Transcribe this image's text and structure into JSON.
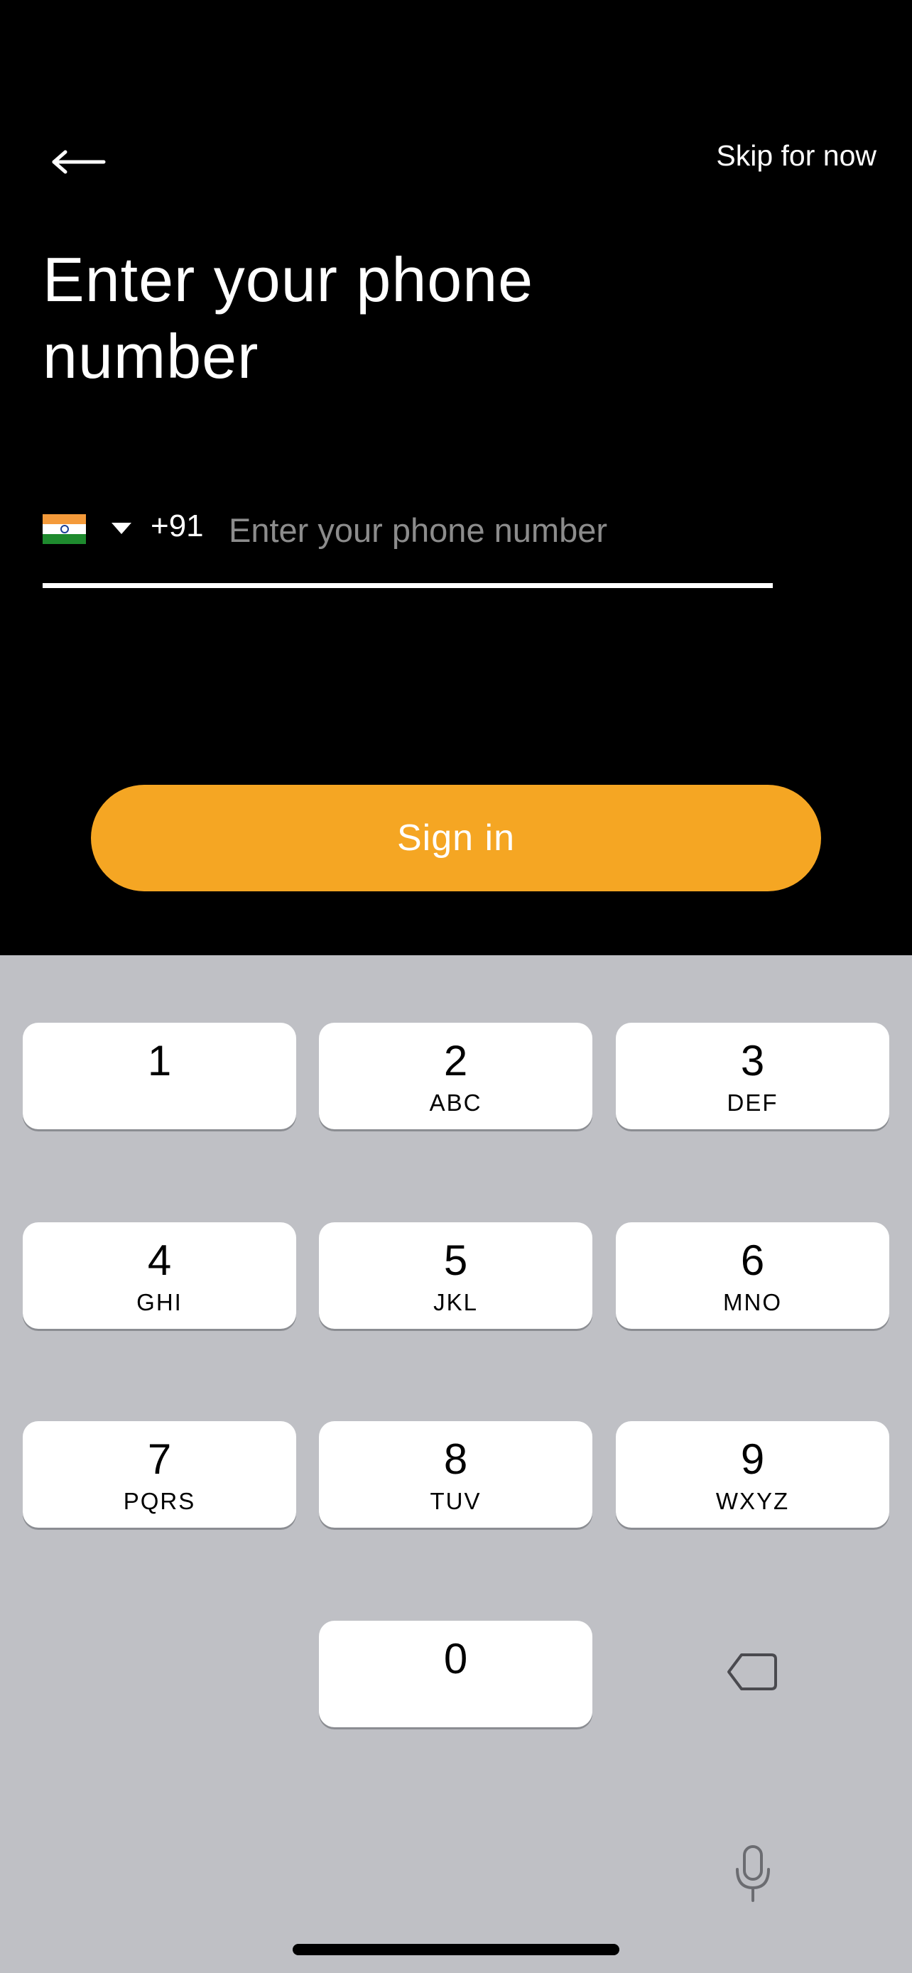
{
  "header": {
    "back_icon": "arrow-left-icon",
    "skip_label": "Skip for now"
  },
  "title": "Enter your phone number",
  "phone": {
    "country_flag": "india-flag-icon",
    "country_code": "+91",
    "value": "",
    "placeholder": "Enter your phone number"
  },
  "sign_in_label": "Sign in",
  "colors": {
    "accent": "#F5A623",
    "background": "#000000",
    "keyboard": "#BFC0C5"
  },
  "keypad": {
    "keys": [
      {
        "num": "1",
        "letters": ""
      },
      {
        "num": "2",
        "letters": "ABC"
      },
      {
        "num": "3",
        "letters": "DEF"
      },
      {
        "num": "4",
        "letters": "GHI"
      },
      {
        "num": "5",
        "letters": "JKL"
      },
      {
        "num": "6",
        "letters": "MNO"
      },
      {
        "num": "7",
        "letters": "PQRS"
      },
      {
        "num": "8",
        "letters": "TUV"
      },
      {
        "num": "9",
        "letters": "WXYZ"
      },
      {
        "num": "0",
        "letters": ""
      }
    ],
    "backspace_icon": "backspace-icon",
    "mic_icon": "microphone-icon"
  }
}
